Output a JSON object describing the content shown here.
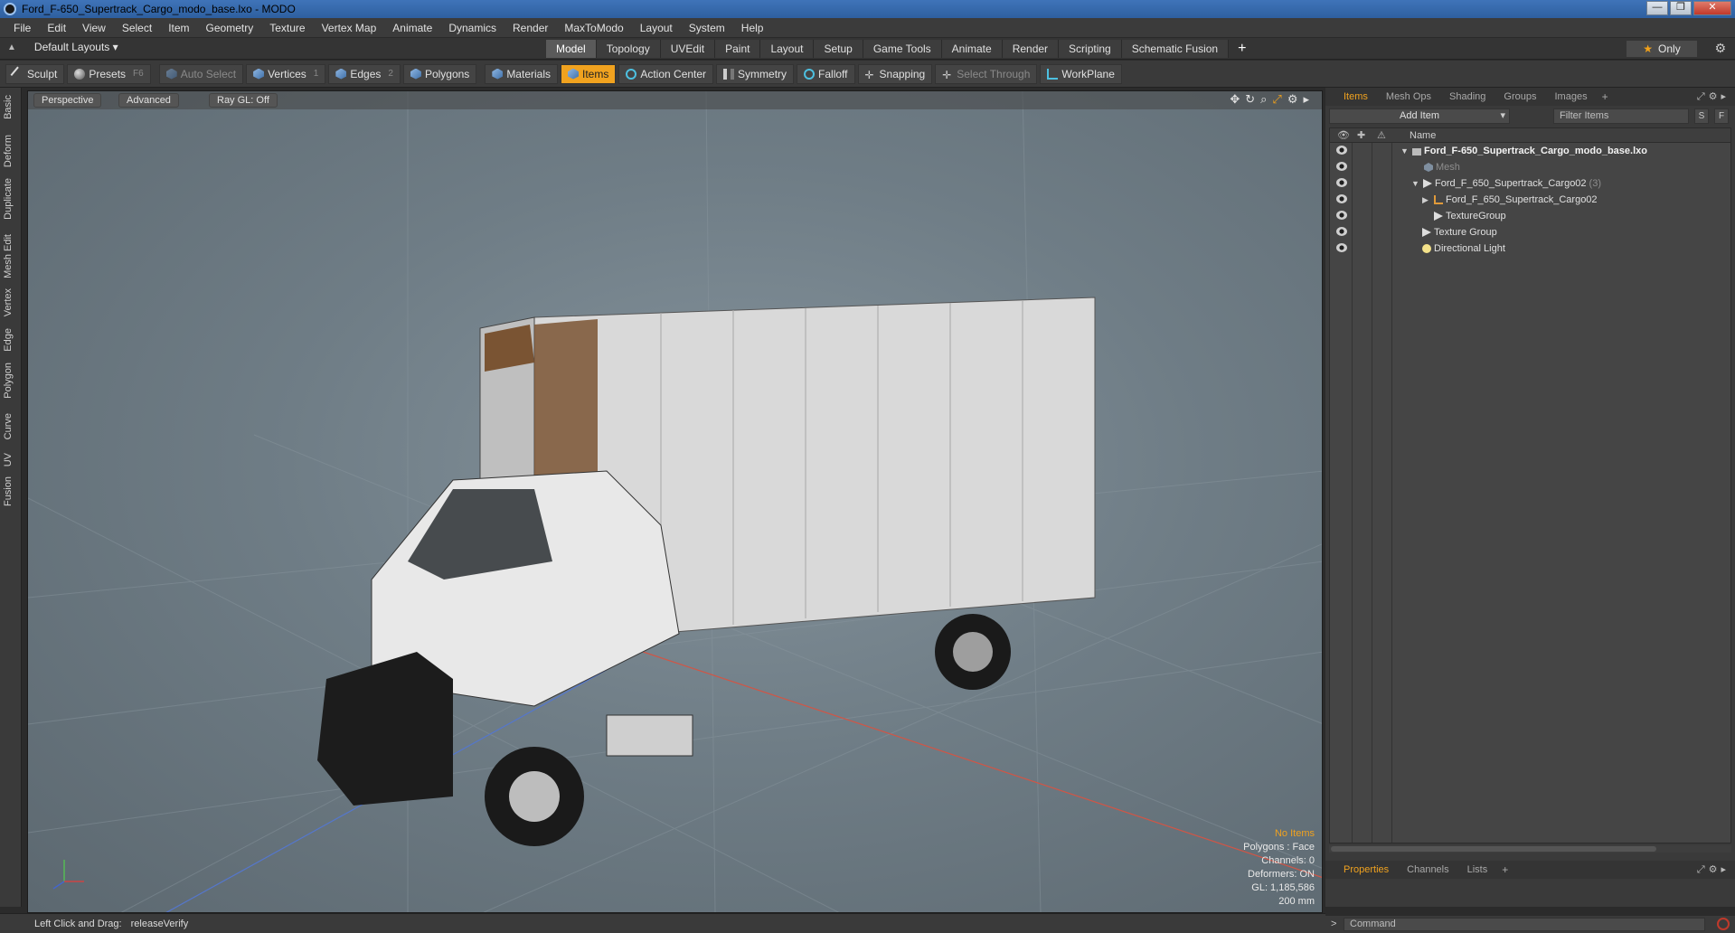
{
  "window": {
    "title": "Ford_F-650_Supertrack_Cargo_modo_base.lxo - MODO",
    "buttons": [
      "—",
      "❐",
      "✕"
    ]
  },
  "menu": [
    "File",
    "Edit",
    "View",
    "Select",
    "Item",
    "Geometry",
    "Texture",
    "Vertex Map",
    "Animate",
    "Dynamics",
    "Render",
    "MaxToModo",
    "Layout",
    "System",
    "Help"
  ],
  "layout": {
    "selector": "Default Layouts ▾",
    "tabs": [
      "Model",
      "Topology",
      "UVEdit",
      "Paint",
      "Layout",
      "Setup",
      "Game Tools",
      "Animate",
      "Render",
      "Scripting",
      "Schematic Fusion"
    ],
    "active_tab": "Model",
    "add": "+",
    "only_label": "Only"
  },
  "toolbar": {
    "sculpt": "Sculpt",
    "presets": "Presets",
    "presets_key": "F6",
    "auto_select": "Auto Select",
    "vertices": "Vertices",
    "vertices_key": "1",
    "edges": "Edges",
    "edges_key": "2",
    "polygons": "Polygons",
    "materials": "Materials",
    "items": "Items",
    "action_center": "Action Center",
    "symmetry": "Symmetry",
    "falloff": "Falloff",
    "snapping": "Snapping",
    "select_through": "Select Through",
    "workplane": "WorkPlane"
  },
  "left_tabs": [
    "Basic",
    "Deform",
    "Duplicate",
    "Mesh Edit",
    "Vertex",
    "Edge",
    "Polygon",
    "Curve",
    "UV",
    "Fusion"
  ],
  "viewport": {
    "view_mode": "Perspective",
    "advanced": "Advanced",
    "ray_gl": "Ray GL: Off",
    "info": {
      "selection": "No Items",
      "polygons": "Polygons : Face",
      "channels": "Channels: 0",
      "deformers": "Deformers: ON",
      "gl": "GL: 1,185,586",
      "grid": "200 mm"
    }
  },
  "items_panel": {
    "tabs": [
      "Items",
      "Mesh Ops",
      "Shading",
      "Groups",
      "Images"
    ],
    "active": "Items",
    "add": "+",
    "add_item": "Add Item",
    "filter": "Filter Items",
    "s_btn": "S",
    "f_btn": "F",
    "column_name": "Name",
    "rows": [
      {
        "label": "Ford_F-650_Supertrack_Cargo_modo_base.lxo",
        "count": ""
      },
      {
        "label": "Mesh",
        "count": ""
      },
      {
        "label": "Ford_F_650_Supertrack_Cargo02",
        "count": "(3)"
      },
      {
        "label": "Ford_F_650_Supertrack_Cargo02",
        "count": ""
      },
      {
        "label": "TextureGroup",
        "count": ""
      },
      {
        "label": "Texture Group",
        "count": ""
      },
      {
        "label": "Directional Light",
        "count": ""
      }
    ]
  },
  "properties_panel": {
    "tabs": [
      "Properties",
      "Channels",
      "Lists"
    ],
    "active": "Properties",
    "add": "+"
  },
  "status": {
    "hint_label": "Left Click and Drag:",
    "hint_value": "releaseVerify"
  },
  "command": {
    "placeholder": "Command",
    "arrow": ">"
  },
  "colors": {
    "accent": "#f0a21f",
    "viewport_bg": "#6f7d86",
    "panel_bg": "#3a3a3a"
  }
}
